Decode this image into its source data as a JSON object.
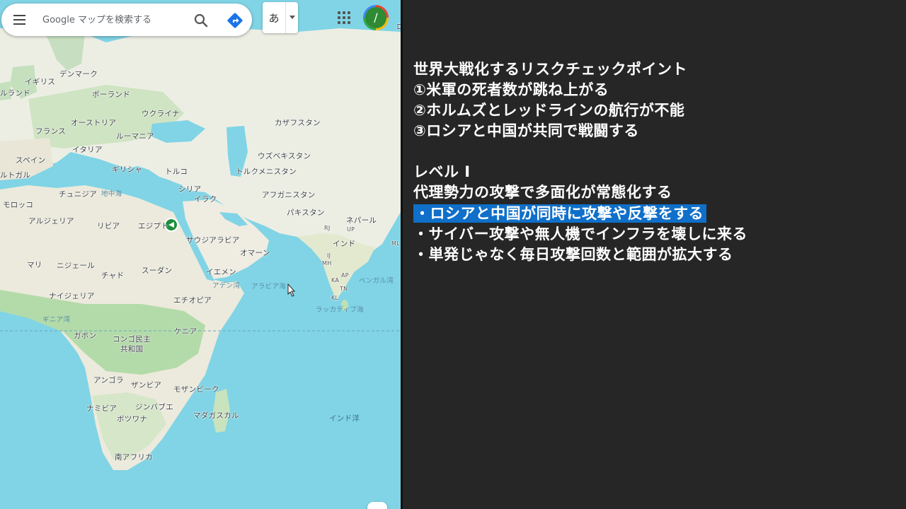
{
  "map": {
    "search": {
      "placeholder": "Google マップを検索する",
      "menu_icon": "hamburger-menu-icon",
      "search_icon": "search-icon",
      "directions_icon": "directions-icon"
    },
    "ime": {
      "label": "あ"
    },
    "avatar": {
      "initial": "/"
    },
    "edge_label": "ロシ",
    "labels": {
      "denmark": "デンマーク",
      "uk": "イギリス",
      "ireland": "ルランド",
      "poland": "ポーランド",
      "ukraine": "ウクライナ",
      "kazakhstan": "カザフスタン",
      "france": "フランス",
      "austria": "オーストリア",
      "romania": "ルーマニア",
      "italy": "イタリア",
      "uzbekistan": "ウズベキスタン",
      "spain": "スペイン",
      "greece": "ギリシャ",
      "turkey": "トルコ",
      "turkmenistan": "トルクメニスタン",
      "portugal": "ルトガル",
      "tunisia": "チュニジア",
      "mediterranean": "地中海",
      "syria": "シリア",
      "iraq": "イラク",
      "afghanistan": "アフガニスタン",
      "morocco": "モロッコ",
      "pakistan": "パキスタン",
      "nepal": "ネパール",
      "algeria": "アルジェリア",
      "libya": "リビア",
      "egypt": "エジプト",
      "saudi": "サウジアラビア",
      "india": "インド",
      "oman": "オマーン",
      "mali": "マリ",
      "niger": "ニジェール",
      "sudan": "スーダン",
      "chad": "チャド",
      "yemen": "イエメン",
      "arabian_sea": "アラビア海",
      "bay_of_bengal": "ベンガル湾",
      "nigeria": "ナイジェリア",
      "ethiopia": "エチオピア",
      "laccadive": "ラッカディブ海",
      "gulf_guinea": "ギニア湾",
      "gabon": "ガボン",
      "kenya": "ケニア",
      "drc": "コンゴ民主",
      "drc2": "共和国",
      "angola": "アンゴラ",
      "zambia": "ザンビア",
      "mozambique": "モザンビーク",
      "namibia": "ナミビア",
      "zimbabwe": "ジンバブエ",
      "botswana": "ボツワナ",
      "madagascar": "マダガスカル",
      "indian_ocean": "インド洋",
      "south_africa": "南アフリカ",
      "aden": "アデン湾",
      "mh": "MH",
      "ap": "AP",
      "ka": "KA",
      "tn": "TN",
      "kl": "KL",
      "up": "UP",
      "rj": "RJ",
      "ij": "IJ",
      "ml": "ML"
    }
  },
  "notes": {
    "lines": [
      "世界大戦化するリスクチェックポイント",
      "①米軍の死者数が跳ね上がる",
      "②ホルムズとレッドラインの航行が不能",
      "③ロシアと中国が共同で戦闘する",
      "",
      "レベル I",
      "代理勢力の攻撃で多面化が常態化する",
      "・ロシアと中国が同時に攻撃や反撃をする",
      "・サイバー攻撃や無人機でインフラを壊しに来る",
      "・単発じゃなく毎日攻撃回数と範囲が拡大する"
    ],
    "highlight_color": "#0f6fc9"
  },
  "colors": {
    "sea": "#7fd3e4",
    "land": "#f1efe9",
    "vegetation": "#b7dcae",
    "notes_bg": "#262626"
  }
}
